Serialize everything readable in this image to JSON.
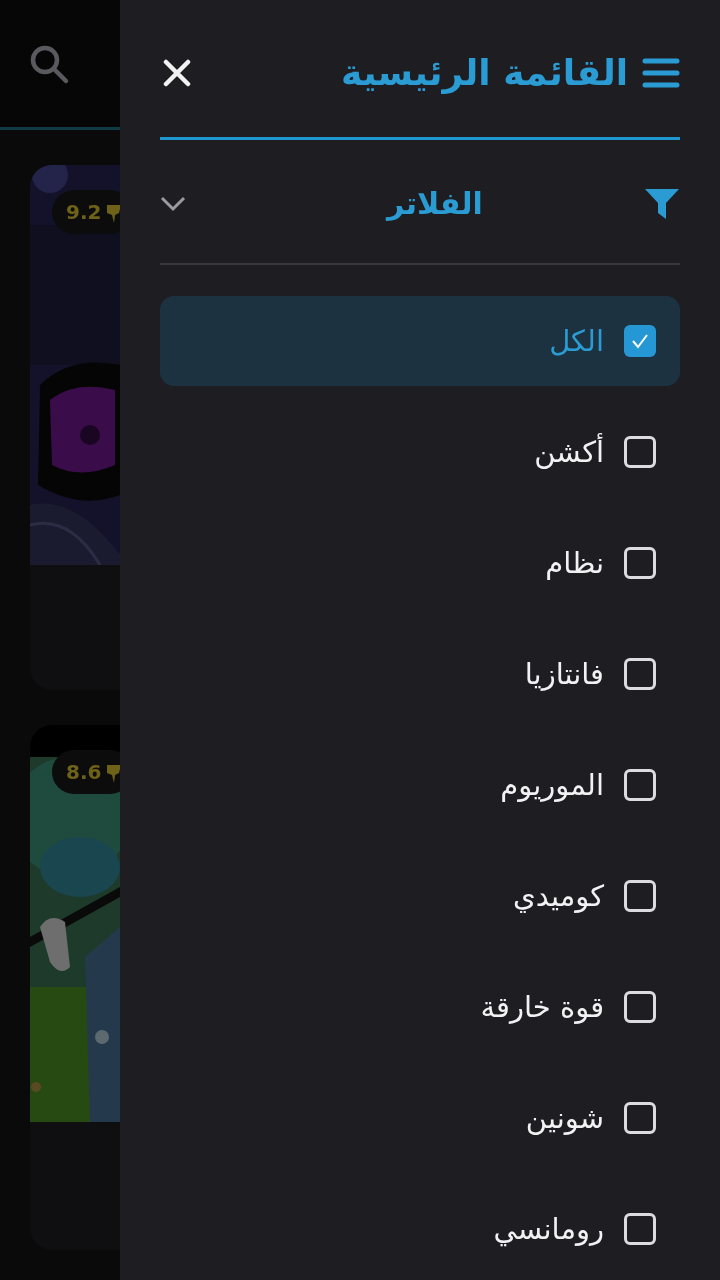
{
  "page": {
    "cards": [
      {
        "rating": "9.2"
      },
      {
        "rating": "8.6"
      }
    ]
  },
  "drawer": {
    "title": "القائمة الرئيسية",
    "filter_section": {
      "title": "الفلاتر",
      "expanded": true
    },
    "filters": [
      {
        "label": "الكل",
        "checked": true,
        "selected": true
      },
      {
        "label": "أكشن",
        "checked": false,
        "selected": false
      },
      {
        "label": "نظام",
        "checked": false,
        "selected": false
      },
      {
        "label": "فانتازيا",
        "checked": false,
        "selected": false
      },
      {
        "label": "الموريوم",
        "checked": false,
        "selected": false
      },
      {
        "label": "كوميدي",
        "checked": false,
        "selected": false
      },
      {
        "label": "قوة خارقة",
        "checked": false,
        "selected": false
      },
      {
        "label": "شونين",
        "checked": false,
        "selected": false
      },
      {
        "label": "رومانسي",
        "checked": false,
        "selected": false
      }
    ]
  }
}
